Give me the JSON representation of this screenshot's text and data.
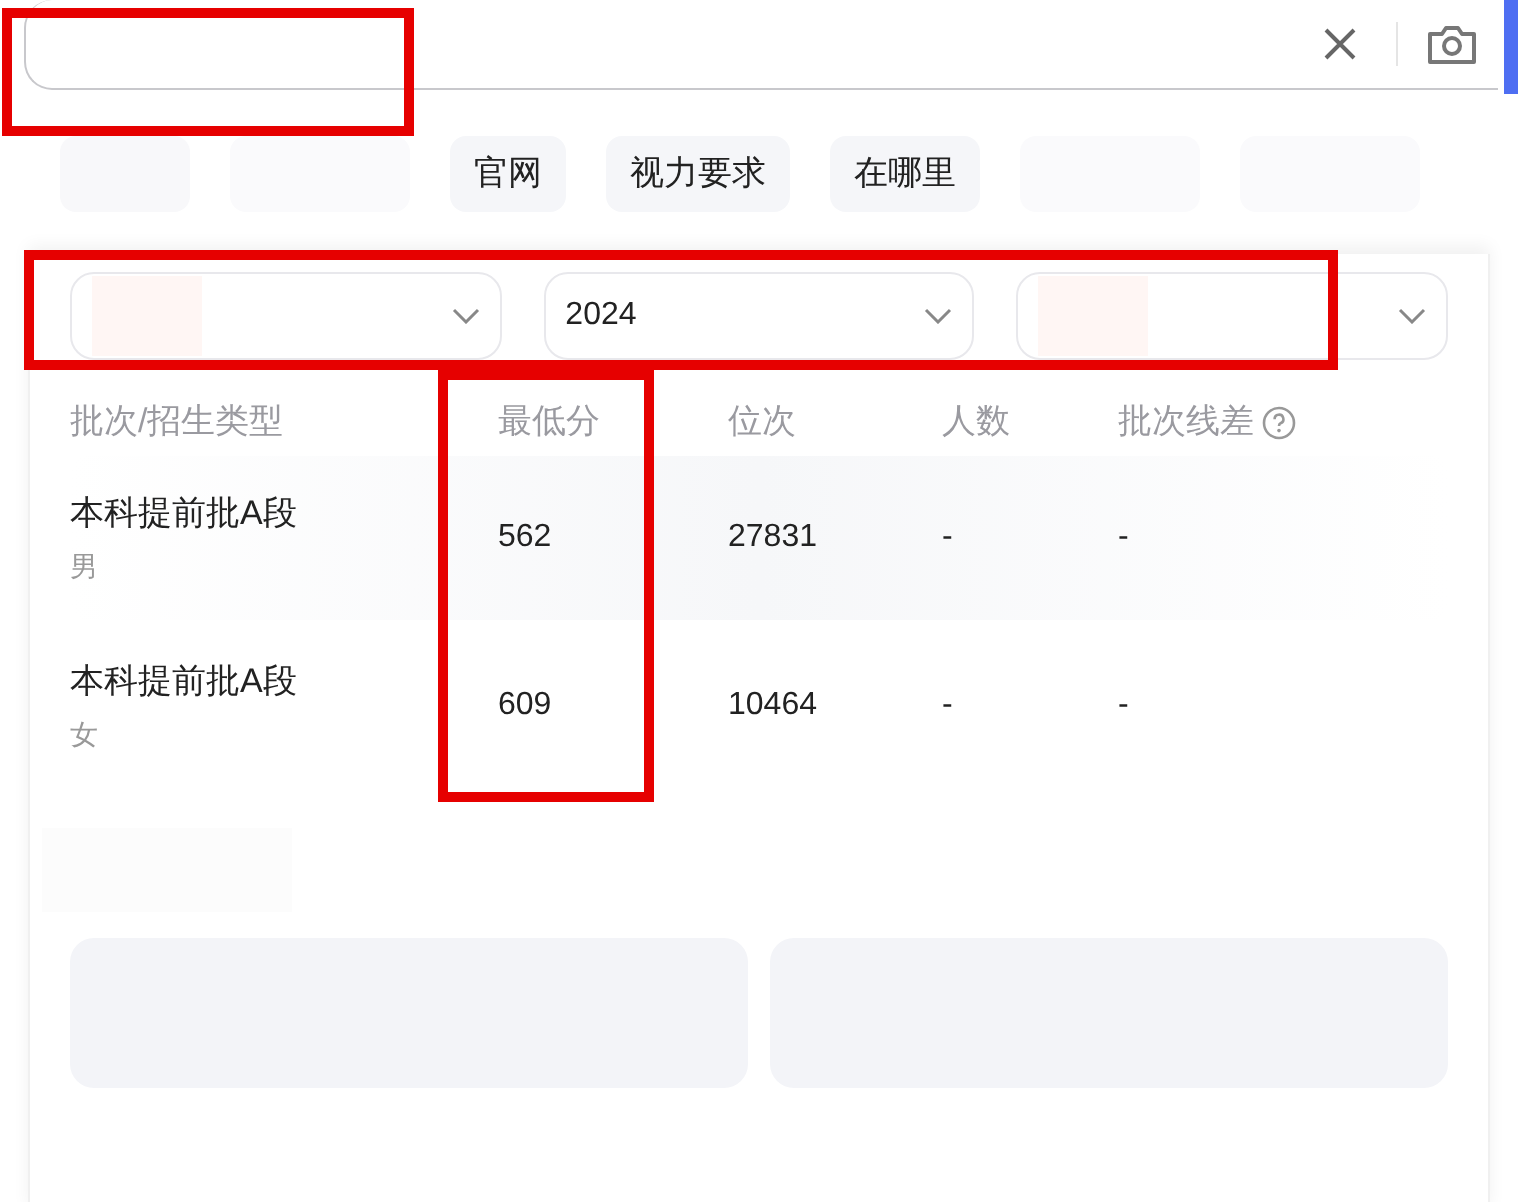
{
  "chips": [
    {
      "label": "官网"
    },
    {
      "label": "视力要求"
    },
    {
      "label": "在哪里"
    }
  ],
  "dropdowns": [
    {
      "kind": "blurred"
    },
    {
      "kind": "value",
      "value": "2024"
    },
    {
      "kind": "blurred"
    }
  ],
  "table": {
    "columns": [
      "批次/招生类型",
      "最低分",
      "位次",
      "人数",
      "批次线差"
    ],
    "rows": [
      {
        "batch": "本科提前批A段",
        "type": "男",
        "min_score": "562",
        "rank": "27831",
        "count": "-",
        "diff": "-"
      },
      {
        "batch": "本科提前批A段",
        "type": "女",
        "min_score": "609",
        "rank": "10464",
        "count": "-",
        "diff": "-"
      }
    ]
  }
}
